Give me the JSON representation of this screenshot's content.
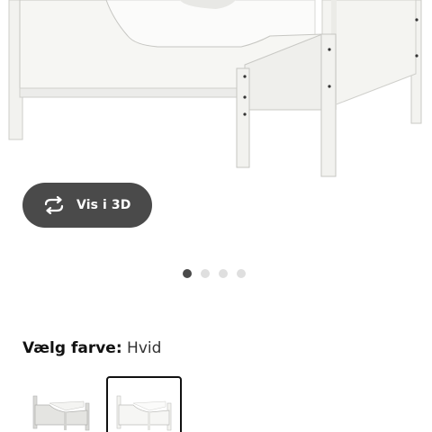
{
  "hero_image": {
    "subject": "bed-image"
  },
  "view_3d_button": {
    "label": "Vis i 3D",
    "icon": "rotate-3d-icon"
  },
  "carousel": {
    "total": 4,
    "active_index": 0
  },
  "color_selector": {
    "label": "Vælg farve:",
    "value": "Hvid",
    "options": [
      {
        "name": "gray-white",
        "selected": false
      },
      {
        "name": "white",
        "selected": true
      }
    ]
  },
  "colors": {
    "button_bg": "#4a4a4a",
    "dot_active": "#4a4a4a",
    "dot_inactive": "#dfdfdf",
    "selected_border": "#111111"
  }
}
